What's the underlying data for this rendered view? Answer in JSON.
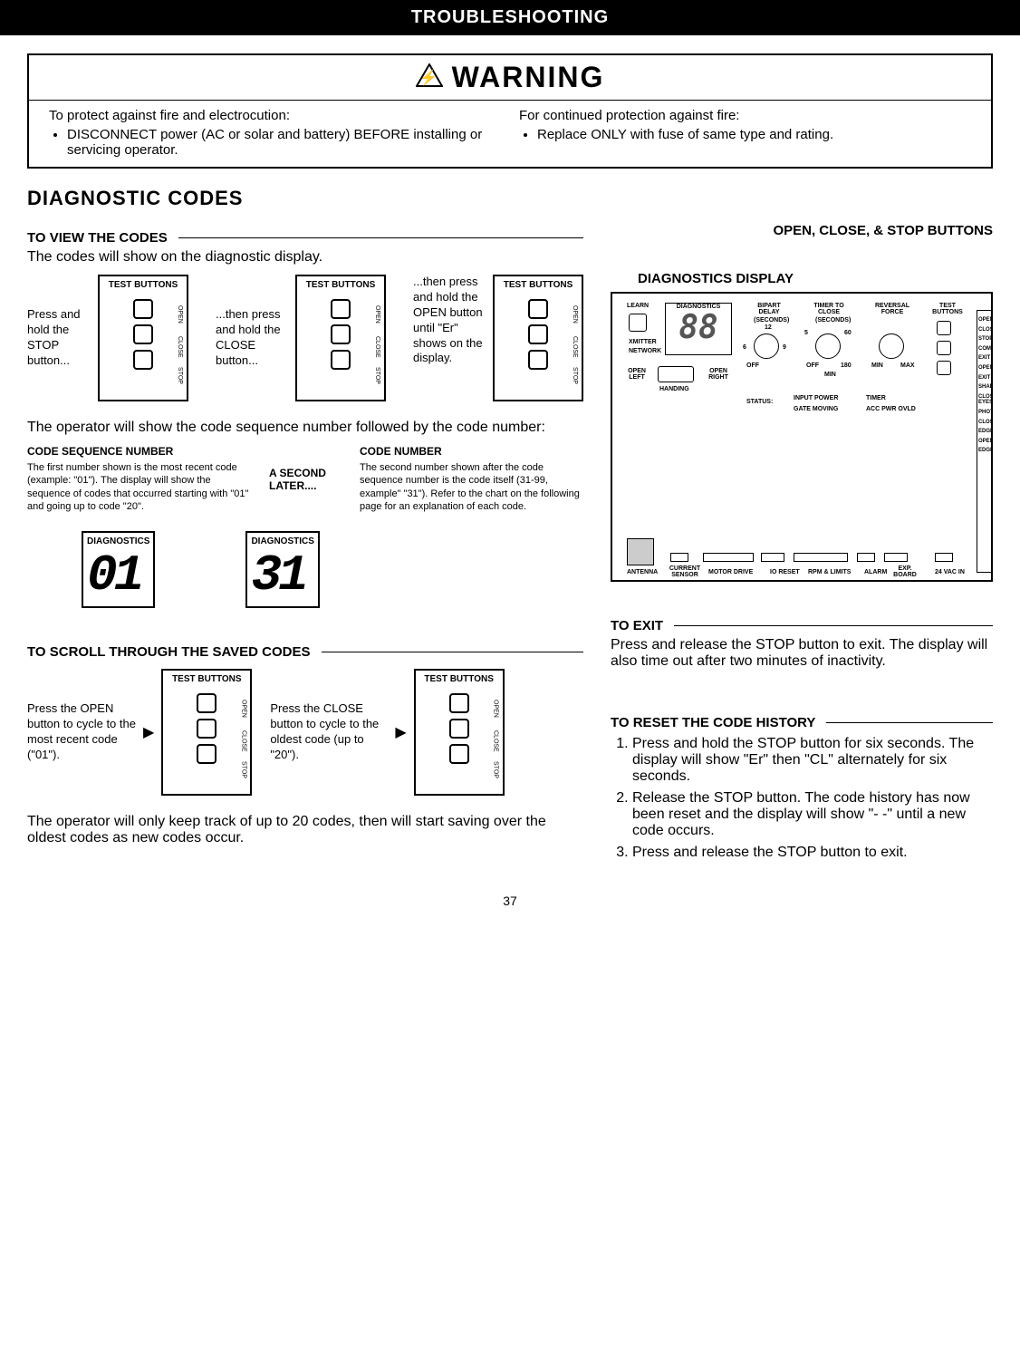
{
  "page_title": "TROUBLESHOOTING",
  "warning": {
    "title": "WARNING",
    "col1_intro": "To protect against fire and electrocution:",
    "col1_bullet": "DISCONNECT power (AC or solar and battery) BEFORE installing or servicing operator.",
    "col2_intro": "For continued protection against fire:",
    "col2_bullet": "Replace ONLY with fuse of same type and rating."
  },
  "section_title": "DIAGNOSTIC CODES",
  "view_codes": {
    "heading": "TO VIEW THE CODES",
    "intro": "The codes will show on the diagnostic display.",
    "step1": "Press and hold the STOP button...",
    "step2": "...then press and hold the CLOSE button...",
    "step3": "...then press and hold the OPEN button until \"Er\" shows on the display.",
    "panel_title": "TEST BUTTONS",
    "btn_open": "OPEN",
    "btn_close": "CLOSE",
    "btn_stop": "STOP"
  },
  "sequence": {
    "intro": "The operator will show the code sequence number followed by the code number:",
    "seq_title": "CODE SEQUENCE NUMBER",
    "seq_text": "The first number shown is the most recent code (example: \"01\"). The display will show the sequence of codes that occurred starting with \"01\" and going up to code \"20\".",
    "mid": "A SECOND LATER....",
    "code_title": "CODE NUMBER",
    "code_text": "The second number shown after the code sequence number is the code itself (31-99, example\" \"31\"). Refer to the chart on the following page for an explanation of each code.",
    "display_label": "DIAGNOSTICS",
    "seq_value": "01",
    "code_value": "31"
  },
  "scroll": {
    "heading": "TO SCROLL THROUGH THE SAVED CODES",
    "open_text": "Press the OPEN button to cycle to the most recent code (\"01\").",
    "close_text": "Press the CLOSE button to cycle to the oldest code (up to \"20\").",
    "note": "The operator will only keep track of up to 20 codes, then will start saving over the oldest codes as new codes occur."
  },
  "right": {
    "buttons_label": "OPEN, CLOSE, & STOP BUTTONS",
    "display_label": "DIAGNOSTICS DISPLAY",
    "board": {
      "learn": "LEARN",
      "diagnostics": "DIAGNOSTICS",
      "xmitter": "XMITTER",
      "network": "NETWORK",
      "open_left": "OPEN LEFT",
      "open_right": "OPEN RIGHT",
      "handing": "HANDING",
      "bipart_delay": "BIPART DELAY",
      "bipart_unit": "(SECONDS)",
      "bipart_max": "12",
      "bipart_marks": [
        "6",
        "9"
      ],
      "off": "OFF",
      "timer_to_close": "TIMER TO CLOSE",
      "timer_unit": "(SECONDS)",
      "timer_marks": [
        "5",
        "60"
      ],
      "timer_min": "MIN",
      "timer_max": "180",
      "reversal_force": "REVERSAL FORCE",
      "rev_min": "MIN",
      "rev_max": "MAX",
      "test_buttons": "TEST BUTTONS",
      "status": "STATUS:",
      "status_items": [
        "INPUT POWER",
        "TIMER",
        "GATE MOVING",
        "ACC PWR OVLD"
      ],
      "antenna": "ANTENNA",
      "current_sensor": "CURRENT SENSOR",
      "motor_drive": "MOTOR DRIVE",
      "io_reset": "IO RESET",
      "rpm_limits": "RPM & LIMITS",
      "alarm": "ALARM",
      "exp_board": "EXP. BOARD",
      "vac_in": "24 VAC IN",
      "side_labels": [
        "OPEN",
        "CLOSE",
        "STOP",
        "COMM",
        "EXIT",
        "OPEN",
        "EXIT",
        "SHADOW",
        "CLOSE EYES",
        "PHOTO",
        "CLOSE",
        "EDGE",
        "OPEN",
        "EDGE"
      ]
    }
  },
  "exit": {
    "heading": "TO EXIT",
    "text": "Press and release the STOP button to exit. The display will also time out after two minutes of inactivity."
  },
  "reset": {
    "heading": "TO RESET THE CODE HISTORY",
    "step1": "Press and hold the STOP button for six seconds. The display will show \"Er\" then \"CL\" alternately for six seconds.",
    "step2": "Release the STOP button. The code history has now been reset and the display will show \"- -\" until a new code occurs.",
    "step3": "Press and release the STOP button to exit."
  },
  "page_number": "37"
}
